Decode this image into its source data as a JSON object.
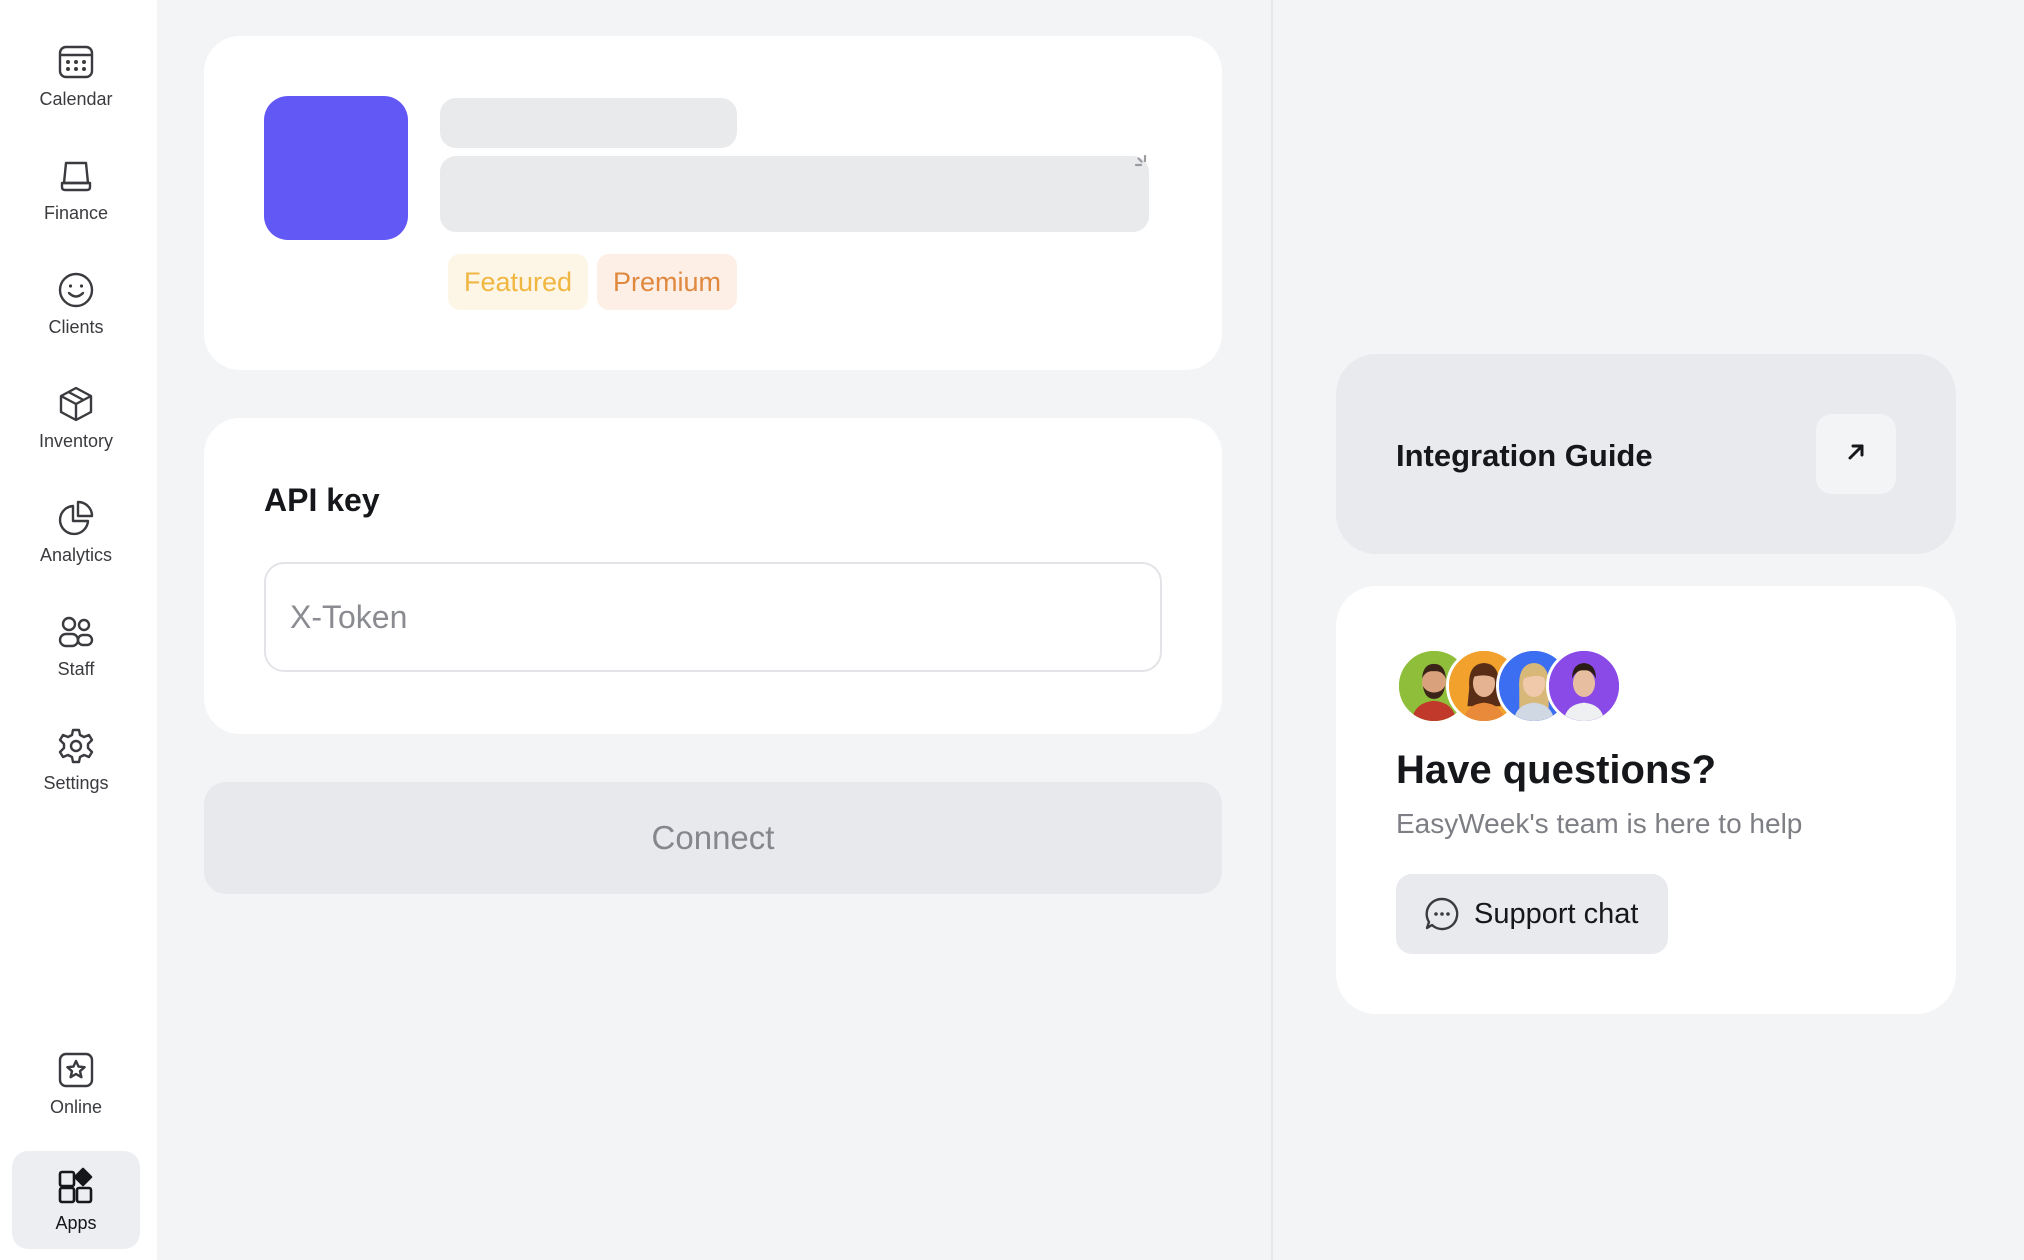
{
  "sidebar": {
    "items": [
      {
        "label": "Calendar",
        "icon": "calendar-icon"
      },
      {
        "label": "Finance",
        "icon": "wallet-icon"
      },
      {
        "label": "Clients",
        "icon": "smiley-icon"
      },
      {
        "label": "Inventory",
        "icon": "box-icon"
      },
      {
        "label": "Analytics",
        "icon": "pie-chart-icon"
      },
      {
        "label": "Staff",
        "icon": "staff-icon"
      },
      {
        "label": "Settings",
        "icon": "gear-icon"
      }
    ],
    "bottom_items": [
      {
        "label": "Online",
        "icon": "star-square-icon"
      },
      {
        "label": "Apps",
        "icon": "apps-icon",
        "active": true
      }
    ]
  },
  "app_card": {
    "logo_color": "#6158f5",
    "badges": [
      {
        "label": "Featured",
        "color": "#f0b640"
      },
      {
        "label": "Premium",
        "color": "#e0893e"
      }
    ]
  },
  "api": {
    "title": "API key",
    "placeholder": "X-Token",
    "value": ""
  },
  "connect": {
    "label": "Connect"
  },
  "guide": {
    "title": "Integration Guide",
    "icon": "arrow-up-right-icon"
  },
  "help": {
    "title": "Have questions?",
    "subtitle": "EasyWeek's team is here to help",
    "button_label": "Support chat",
    "button_icon": "chat-bubble-icon",
    "avatar_colors": [
      "#8fbf3a",
      "#f2a22c",
      "#3b6ef0",
      "#8a4ae8"
    ]
  }
}
